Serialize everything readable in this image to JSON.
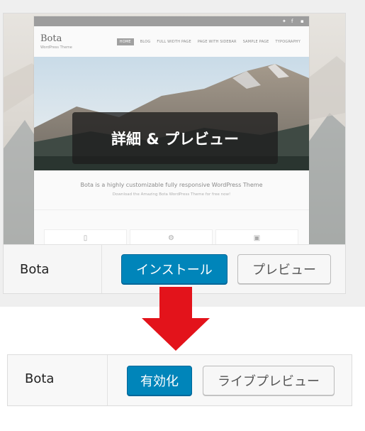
{
  "before": {
    "theme_name": "Bota",
    "overlay_label": "詳細 & プレビュー",
    "install_label": "インストール",
    "preview_label": "プレビュー",
    "screenshot": {
      "site_title": "Bota",
      "site_tagline": "WordPress Theme",
      "nav": [
        "HOME",
        "BLOG",
        "FULL WIDTH PAGE",
        "PAGE WITH SIDEBAR",
        "SAMPLE PAGE",
        "TYPOGRAPHY"
      ],
      "headline": "Bota is a highly customizable fully responsive WordPress Theme",
      "subline": "Download the Amazing Bota WordPress Theme for free now!"
    }
  },
  "arrow": {
    "color": "#e3131b",
    "direction": "down"
  },
  "after": {
    "theme_name": "Bota",
    "activate_label": "有効化",
    "live_preview_label": "ライブプレビュー"
  },
  "colors": {
    "primary": "#0085ba",
    "primary_border": "#006799"
  }
}
